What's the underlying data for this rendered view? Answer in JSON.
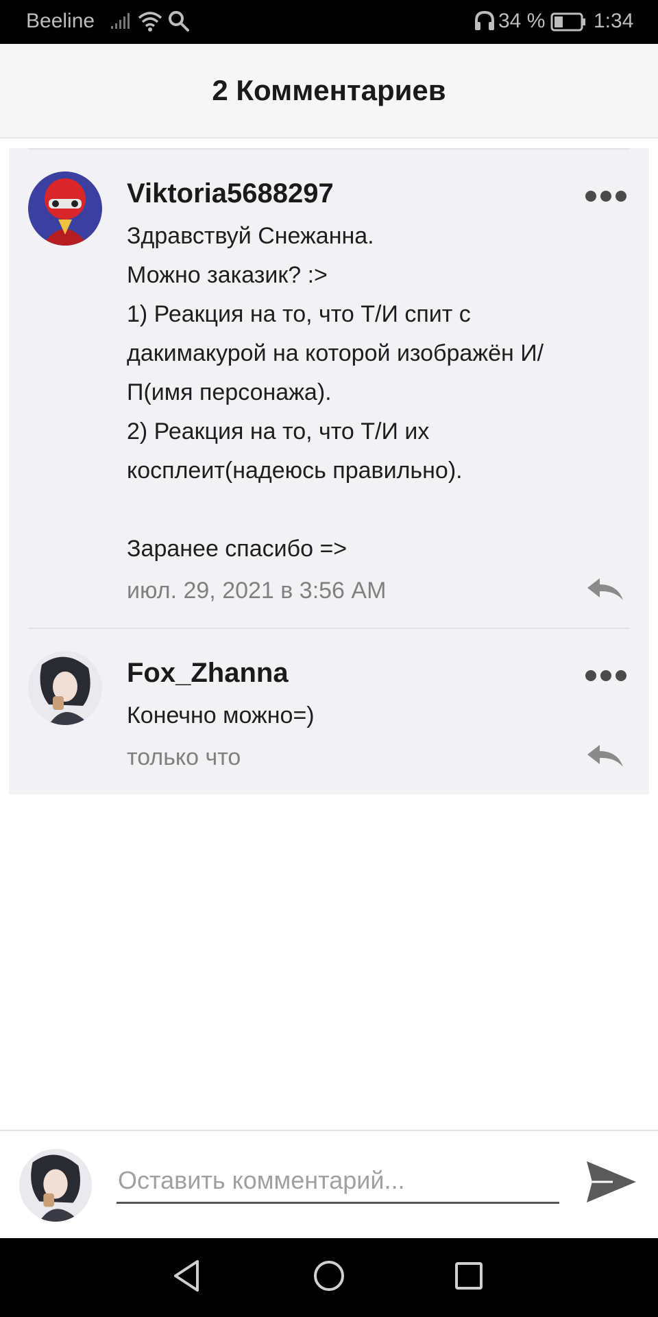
{
  "status_bar": {
    "carrier": "Beeline",
    "battery_text": "34 %",
    "time": "1:34",
    "battery_level": 0.34
  },
  "header": {
    "title": "2 Комментариев"
  },
  "comments": [
    {
      "author": "Viktoria5688297",
      "text": "Здравствуй Снежанна.\nМожно заказик? :>\n1) Реакция на то, что Т/И спит с дакимакурой на которой изображён И/П(имя персонажа).\n2) Реакция на то, что Т/И их косплеит(надеюсь правильно).\n\nЗаранее спасибо =>",
      "date": "июл. 29, 2021 в 3:56 AM"
    },
    {
      "author": "Fox_Zhanna",
      "text": "Конечно можно=)",
      "date": "только что"
    }
  ],
  "input": {
    "placeholder": "Оставить комментарий..."
  },
  "icons": {
    "more": "more-dots-icon",
    "reply": "reply-arrow-icon",
    "send": "send-icon",
    "nav_back": "triangle-back-icon",
    "nav_home": "circle-home-icon",
    "nav_recent": "square-recent-icon"
  }
}
